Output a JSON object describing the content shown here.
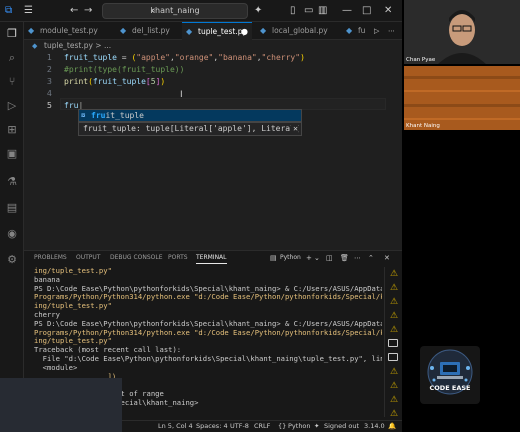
{
  "titlebar": {
    "search_text": "khant_naing"
  },
  "tabs": [
    {
      "label": "module_test.py",
      "modified": false
    },
    {
      "label": "del_list.py",
      "modified": false
    },
    {
      "label": "tuple_test.py",
      "modified": true
    },
    {
      "label": "local_global.py",
      "modified": false
    },
    {
      "label": "fu",
      "modified": false
    }
  ],
  "breadcrumb": "tuple_test.py > ...",
  "editor": {
    "line_numbers": [
      "1",
      "2",
      "3",
      "4",
      "5"
    ],
    "typed": "fru",
    "suggestion_match": "fru",
    "suggestion_rest": "it_tuple",
    "suggestion_detail": "fruit_tuple: tuple[Literal['apple'], Literal['"
  },
  "panel": {
    "tabs": [
      "PROBLEMS",
      "OUTPUT",
      "DEBUG CONSOLE",
      "PORTS",
      "TERMINAL"
    ],
    "active_tab": "TERMINAL",
    "terminal_profile": "Python",
    "lines": [
      {
        "text": "ing/tuple_test.py\"",
        "style": "y"
      },
      {
        "text": "banana",
        "style": ""
      },
      {
        "text": "PS D:\\Code Ease\\Python\\pythonforkids\\Special\\khant_naing> & C:/Users/ASUS/AppData/Local/",
        "style": "ps"
      },
      {
        "text": "Programs/Python/Python314/python.exe \"d:/Code Ease/Python/pythonforkids/Special/khant_na",
        "style": "y"
      },
      {
        "text": "ing/tuple_test.py\"",
        "style": "y"
      },
      {
        "text": "cherry",
        "style": ""
      },
      {
        "text": "PS D:\\Code Ease\\Python\\pythonforkids\\Special\\khant_naing> & C:/Users/ASUS/AppData/Local/",
        "style": "ps"
      },
      {
        "text": "Programs/Python/Python314/python.exe \"d:/Code Ease/Python/pythonforkids/Special/khant_na",
        "style": "y"
      },
      {
        "text": "ing/tuple_test.py\"",
        "style": "y"
      },
      {
        "text": "Traceback (most recent call last):",
        "style": ""
      },
      {
        "text": "  File \"d:\\Code Ease\\Python\\pythonforkids\\Special\\khant_naing\\tuple_test.py\", line 3, in",
        "style": ""
      },
      {
        "text": "  <module>",
        "style": ""
      },
      {
        "text": "                 ])",
        "style": "y"
      },
      {
        "text": "                 ^",
        "style": ""
      },
      {
        "text": "                  out of range",
        "style": ""
      },
      {
        "text": "                 \\Special\\khant_naing> ",
        "style": ""
      }
    ]
  },
  "statusbar": {
    "position": "Ln 5, Col 4",
    "spaces": "Spaces: 4",
    "encoding": "UTF-8",
    "eol": "CRLF",
    "language": "Python",
    "account": "Signed out",
    "version": "3.14.0"
  },
  "participants": [
    {
      "name": "Chan Pyae"
    },
    {
      "name": "Khant Naing"
    }
  ],
  "logo_text": "CODE EASE",
  "colors": {
    "editor_bg": "#1f1f1f",
    "accent": "#0078d4",
    "string": "#ce9178"
  }
}
